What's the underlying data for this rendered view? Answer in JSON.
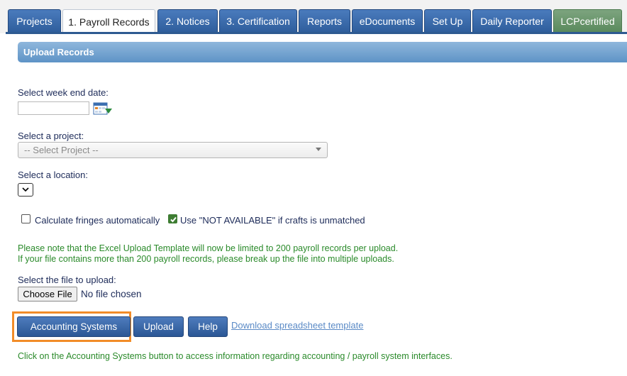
{
  "tabs": [
    {
      "label": "Projects"
    },
    {
      "label": "1. Payroll Records"
    },
    {
      "label": "2. Notices"
    },
    {
      "label": "3. Certification"
    },
    {
      "label": "Reports"
    },
    {
      "label": "eDocuments"
    },
    {
      "label": "Set Up"
    },
    {
      "label": "Daily Reporter"
    },
    {
      "label": "LCPcertified"
    }
  ],
  "section": {
    "title": "Upload Records"
  },
  "form": {
    "week_end_label": "Select week end date:",
    "week_end_value": "",
    "project_label": "Select a project:",
    "project_placeholder": "-- Select Project --",
    "location_label": "Select a location:",
    "location_value": ""
  },
  "options": {
    "calc_fringes_label": "Calculate fringes automatically",
    "calc_fringes_checked": false,
    "not_available_label": "Use \"NOT AVAILABLE\" if crafts is unmatched",
    "not_available_checked": true
  },
  "notice": {
    "line1": "Please note that the Excel Upload Template will now be limited to 200 payroll records per upload.",
    "line2": "If your file contains more than 200 payroll records, please break up the file into multiple uploads."
  },
  "upload": {
    "file_label": "Select the file to upload:",
    "choose_label": "Choose File",
    "no_file": "No file chosen"
  },
  "actions": {
    "accounting": "Accounting Systems",
    "upload": "Upload",
    "help": "Help",
    "download_link": "Download spreadsheet template"
  },
  "footer_note": "Click on the Accounting Systems button to access information regarding accounting / payroll system interfaces.",
  "colors": {
    "tab_blue": "#2f5e9c",
    "tab_green": "#5a8a5d",
    "note_green": "#2a8a2a",
    "highlight_orange": "#f28c28"
  }
}
